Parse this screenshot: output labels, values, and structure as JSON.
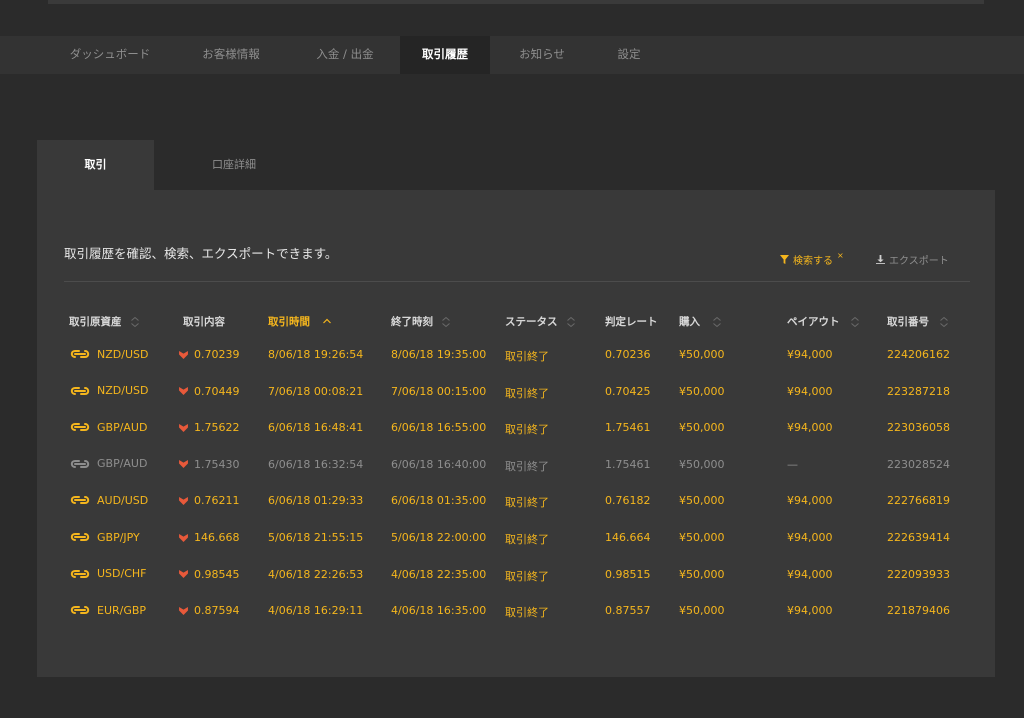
{
  "nav": {
    "tabs": [
      {
        "label": "ダッシュボード"
      },
      {
        "label": "お客様情報"
      },
      {
        "label": "入金 / 出金"
      },
      {
        "label": "取引履歴"
      },
      {
        "label": "お知らせ"
      },
      {
        "label": "設定"
      }
    ],
    "active_index": 3
  },
  "subtabs": [
    {
      "label": "取引"
    },
    {
      "label": "口座詳細"
    }
  ],
  "panel": {
    "intro": "取引履歴を確認、検索、エクスポートできます。",
    "search_label": "検索する",
    "search_suffix": "×",
    "export_label": "エクスポート"
  },
  "table": {
    "columns": [
      {
        "label": "取引原資産",
        "sorted": false
      },
      {
        "label": "取引内容",
        "sorted": null
      },
      {
        "label": "取引時間",
        "sorted": true
      },
      {
        "label": "終了時刻",
        "sorted": false
      },
      {
        "label": "ステータス",
        "sorted": false
      },
      {
        "label": "判定レート",
        "sorted": null
      },
      {
        "label": "購入",
        "sorted": false
      },
      {
        "label": "ペイアウト",
        "sorted": false
      },
      {
        "label": "取引番号",
        "sorted": false
      }
    ],
    "rows": [
      {
        "asset": "NZD/USD",
        "direction": "down",
        "open_rate": "0.70239",
        "open_time": "8/06/18 19:26:54",
        "close_time": "8/06/18 19:35:00",
        "status": "取引終了",
        "close_rate": "0.70236",
        "amount": "¥50,000",
        "payout": "¥94,000",
        "id": "224206162",
        "muted": false
      },
      {
        "asset": "NZD/USD",
        "direction": "down",
        "open_rate": "0.70449",
        "open_time": "7/06/18 00:08:21",
        "close_time": "7/06/18 00:15:00",
        "status": "取引終了",
        "close_rate": "0.70425",
        "amount": "¥50,000",
        "payout": "¥94,000",
        "id": "223287218",
        "muted": false
      },
      {
        "asset": "GBP/AUD",
        "direction": "down",
        "open_rate": "1.75622",
        "open_time": "6/06/18 16:48:41",
        "close_time": "6/06/18 16:55:00",
        "status": "取引終了",
        "close_rate": "1.75461",
        "amount": "¥50,000",
        "payout": "¥94,000",
        "id": "223036058",
        "muted": false
      },
      {
        "asset": "GBP/AUD",
        "direction": "down",
        "open_rate": "1.75430",
        "open_time": "6/06/18 16:32:54",
        "close_time": "6/06/18 16:40:00",
        "status": "取引終了",
        "close_rate": "1.75461",
        "amount": "¥50,000",
        "payout": "—",
        "id": "223028524",
        "muted": true
      },
      {
        "asset": "AUD/USD",
        "direction": "down",
        "open_rate": "0.76211",
        "open_time": "6/06/18 01:29:33",
        "close_time": "6/06/18 01:35:00",
        "status": "取引終了",
        "close_rate": "0.76182",
        "amount": "¥50,000",
        "payout": "¥94,000",
        "id": "222766819",
        "muted": false
      },
      {
        "asset": "GBP/JPY",
        "direction": "down",
        "open_rate": "146.668",
        "open_time": "5/06/18 21:55:15",
        "close_time": "5/06/18 22:00:00",
        "status": "取引終了",
        "close_rate": "146.664",
        "amount": "¥50,000",
        "payout": "¥94,000",
        "id": "222639414",
        "muted": false
      },
      {
        "asset": "USD/CHF",
        "direction": "down",
        "open_rate": "0.98545",
        "open_time": "4/06/18 22:26:53",
        "close_time": "4/06/18 22:35:00",
        "status": "取引終了",
        "close_rate": "0.98515",
        "amount": "¥50,000",
        "payout": "¥94,000",
        "id": "222093933",
        "muted": false
      },
      {
        "asset": "EUR/GBP",
        "direction": "down",
        "open_rate": "0.87594",
        "open_time": "4/06/18 16:29:11",
        "close_time": "4/06/18 16:35:00",
        "status": "取引終了",
        "close_rate": "0.87557",
        "amount": "¥50,000",
        "payout": "¥94,000",
        "id": "221879406",
        "muted": false
      }
    ]
  },
  "colors": {
    "accent": "#f5b61d",
    "muted": "#8e8e8e",
    "down": "#e8593a",
    "background": "#2b2b2b",
    "panel": "#393939"
  },
  "icons": {
    "asset": "currency-pair-icon",
    "direction_down": "down-arrow-icon",
    "search": "filter-icon",
    "export": "download-icon",
    "sort": "sort-updown-icon"
  }
}
